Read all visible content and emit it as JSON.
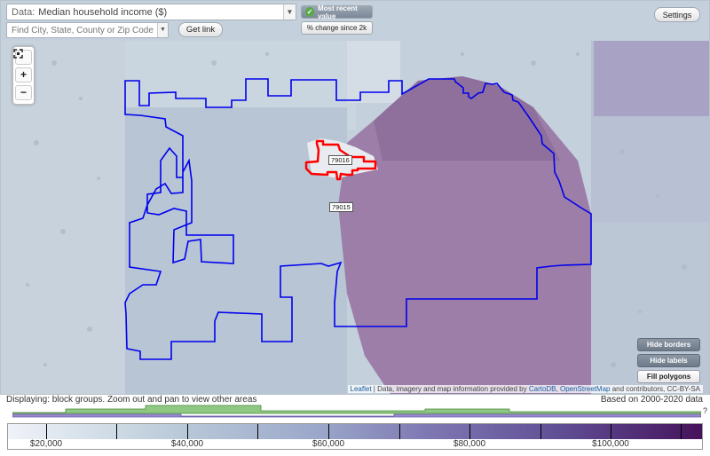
{
  "controls": {
    "data_prefix": "Data:",
    "data_value": "Median household income ($)",
    "search_placeholder": "Find City, State, County or Zip Code",
    "get_link_label": "Get link",
    "most_recent_label": "Most recent value",
    "change_label": "% change since 2k",
    "settings_label": "Settings"
  },
  "zoom": {
    "plus_label": "+",
    "minus_label": "−"
  },
  "map": {
    "zip_labels": [
      "79016",
      "79015"
    ],
    "toggles": {
      "hide_borders": "Hide borders",
      "hide_labels": "Hide labels",
      "fill_polygons": "Fill polygons"
    },
    "attribution": {
      "leaflet": "Leaflet",
      "text": " | Data, imagery and map information provided by ",
      "carto": "CartoDB",
      "osm": "OpenStreetMap",
      "tail": " and contributors, CC-BY-SA"
    },
    "colors": {
      "boundary": "#0000ee",
      "highlight": "#ff0000"
    }
  },
  "status": {
    "displaying": "Displaying: block groups. Zoom out and pan to view other areas",
    "based_on": "Based on 2000-2020 data",
    "histogram_more": "?"
  },
  "legend": {
    "labels": [
      "$20,000",
      "$40,000",
      "$60,000",
      "$80,000",
      "$100,000"
    ]
  }
}
